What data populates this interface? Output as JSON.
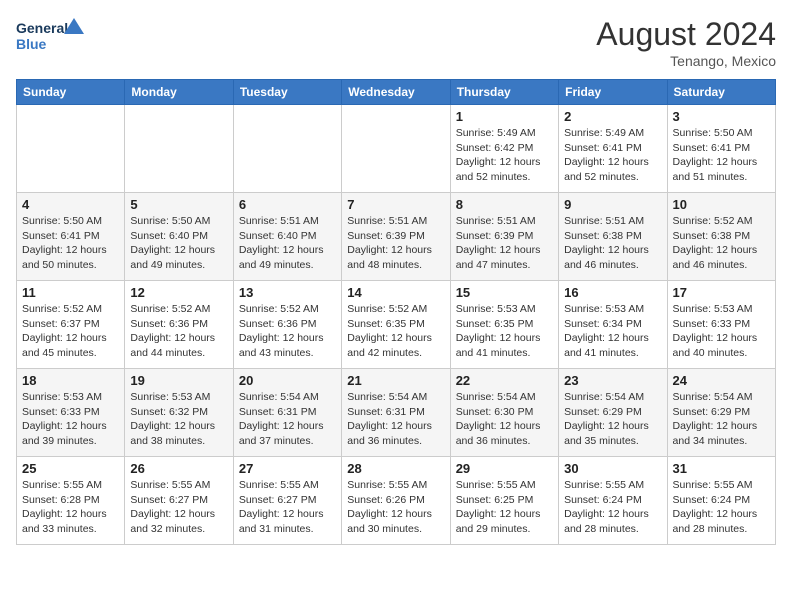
{
  "header": {
    "logo_line1": "General",
    "logo_line2": "Blue",
    "month_year": "August 2024",
    "location": "Tenango, Mexico"
  },
  "days_of_week": [
    "Sunday",
    "Monday",
    "Tuesday",
    "Wednesday",
    "Thursday",
    "Friday",
    "Saturday"
  ],
  "weeks": [
    [
      {
        "day": "",
        "detail": ""
      },
      {
        "day": "",
        "detail": ""
      },
      {
        "day": "",
        "detail": ""
      },
      {
        "day": "",
        "detail": ""
      },
      {
        "day": "1",
        "detail": "Sunrise: 5:49 AM\nSunset: 6:42 PM\nDaylight: 12 hours\nand 52 minutes."
      },
      {
        "day": "2",
        "detail": "Sunrise: 5:49 AM\nSunset: 6:41 PM\nDaylight: 12 hours\nand 52 minutes."
      },
      {
        "day": "3",
        "detail": "Sunrise: 5:50 AM\nSunset: 6:41 PM\nDaylight: 12 hours\nand 51 minutes."
      }
    ],
    [
      {
        "day": "4",
        "detail": "Sunrise: 5:50 AM\nSunset: 6:41 PM\nDaylight: 12 hours\nand 50 minutes."
      },
      {
        "day": "5",
        "detail": "Sunrise: 5:50 AM\nSunset: 6:40 PM\nDaylight: 12 hours\nand 49 minutes."
      },
      {
        "day": "6",
        "detail": "Sunrise: 5:51 AM\nSunset: 6:40 PM\nDaylight: 12 hours\nand 49 minutes."
      },
      {
        "day": "7",
        "detail": "Sunrise: 5:51 AM\nSunset: 6:39 PM\nDaylight: 12 hours\nand 48 minutes."
      },
      {
        "day": "8",
        "detail": "Sunrise: 5:51 AM\nSunset: 6:39 PM\nDaylight: 12 hours\nand 47 minutes."
      },
      {
        "day": "9",
        "detail": "Sunrise: 5:51 AM\nSunset: 6:38 PM\nDaylight: 12 hours\nand 46 minutes."
      },
      {
        "day": "10",
        "detail": "Sunrise: 5:52 AM\nSunset: 6:38 PM\nDaylight: 12 hours\nand 46 minutes."
      }
    ],
    [
      {
        "day": "11",
        "detail": "Sunrise: 5:52 AM\nSunset: 6:37 PM\nDaylight: 12 hours\nand 45 minutes."
      },
      {
        "day": "12",
        "detail": "Sunrise: 5:52 AM\nSunset: 6:36 PM\nDaylight: 12 hours\nand 44 minutes."
      },
      {
        "day": "13",
        "detail": "Sunrise: 5:52 AM\nSunset: 6:36 PM\nDaylight: 12 hours\nand 43 minutes."
      },
      {
        "day": "14",
        "detail": "Sunrise: 5:52 AM\nSunset: 6:35 PM\nDaylight: 12 hours\nand 42 minutes."
      },
      {
        "day": "15",
        "detail": "Sunrise: 5:53 AM\nSunset: 6:35 PM\nDaylight: 12 hours\nand 41 minutes."
      },
      {
        "day": "16",
        "detail": "Sunrise: 5:53 AM\nSunset: 6:34 PM\nDaylight: 12 hours\nand 41 minutes."
      },
      {
        "day": "17",
        "detail": "Sunrise: 5:53 AM\nSunset: 6:33 PM\nDaylight: 12 hours\nand 40 minutes."
      }
    ],
    [
      {
        "day": "18",
        "detail": "Sunrise: 5:53 AM\nSunset: 6:33 PM\nDaylight: 12 hours\nand 39 minutes."
      },
      {
        "day": "19",
        "detail": "Sunrise: 5:53 AM\nSunset: 6:32 PM\nDaylight: 12 hours\nand 38 minutes."
      },
      {
        "day": "20",
        "detail": "Sunrise: 5:54 AM\nSunset: 6:31 PM\nDaylight: 12 hours\nand 37 minutes."
      },
      {
        "day": "21",
        "detail": "Sunrise: 5:54 AM\nSunset: 6:31 PM\nDaylight: 12 hours\nand 36 minutes."
      },
      {
        "day": "22",
        "detail": "Sunrise: 5:54 AM\nSunset: 6:30 PM\nDaylight: 12 hours\nand 36 minutes."
      },
      {
        "day": "23",
        "detail": "Sunrise: 5:54 AM\nSunset: 6:29 PM\nDaylight: 12 hours\nand 35 minutes."
      },
      {
        "day": "24",
        "detail": "Sunrise: 5:54 AM\nSunset: 6:29 PM\nDaylight: 12 hours\nand 34 minutes."
      }
    ],
    [
      {
        "day": "25",
        "detail": "Sunrise: 5:55 AM\nSunset: 6:28 PM\nDaylight: 12 hours\nand 33 minutes."
      },
      {
        "day": "26",
        "detail": "Sunrise: 5:55 AM\nSunset: 6:27 PM\nDaylight: 12 hours\nand 32 minutes."
      },
      {
        "day": "27",
        "detail": "Sunrise: 5:55 AM\nSunset: 6:27 PM\nDaylight: 12 hours\nand 31 minutes."
      },
      {
        "day": "28",
        "detail": "Sunrise: 5:55 AM\nSunset: 6:26 PM\nDaylight: 12 hours\nand 30 minutes."
      },
      {
        "day": "29",
        "detail": "Sunrise: 5:55 AM\nSunset: 6:25 PM\nDaylight: 12 hours\nand 29 minutes."
      },
      {
        "day": "30",
        "detail": "Sunrise: 5:55 AM\nSunset: 6:24 PM\nDaylight: 12 hours\nand 28 minutes."
      },
      {
        "day": "31",
        "detail": "Sunrise: 5:55 AM\nSunset: 6:24 PM\nDaylight: 12 hours\nand 28 minutes."
      }
    ]
  ]
}
